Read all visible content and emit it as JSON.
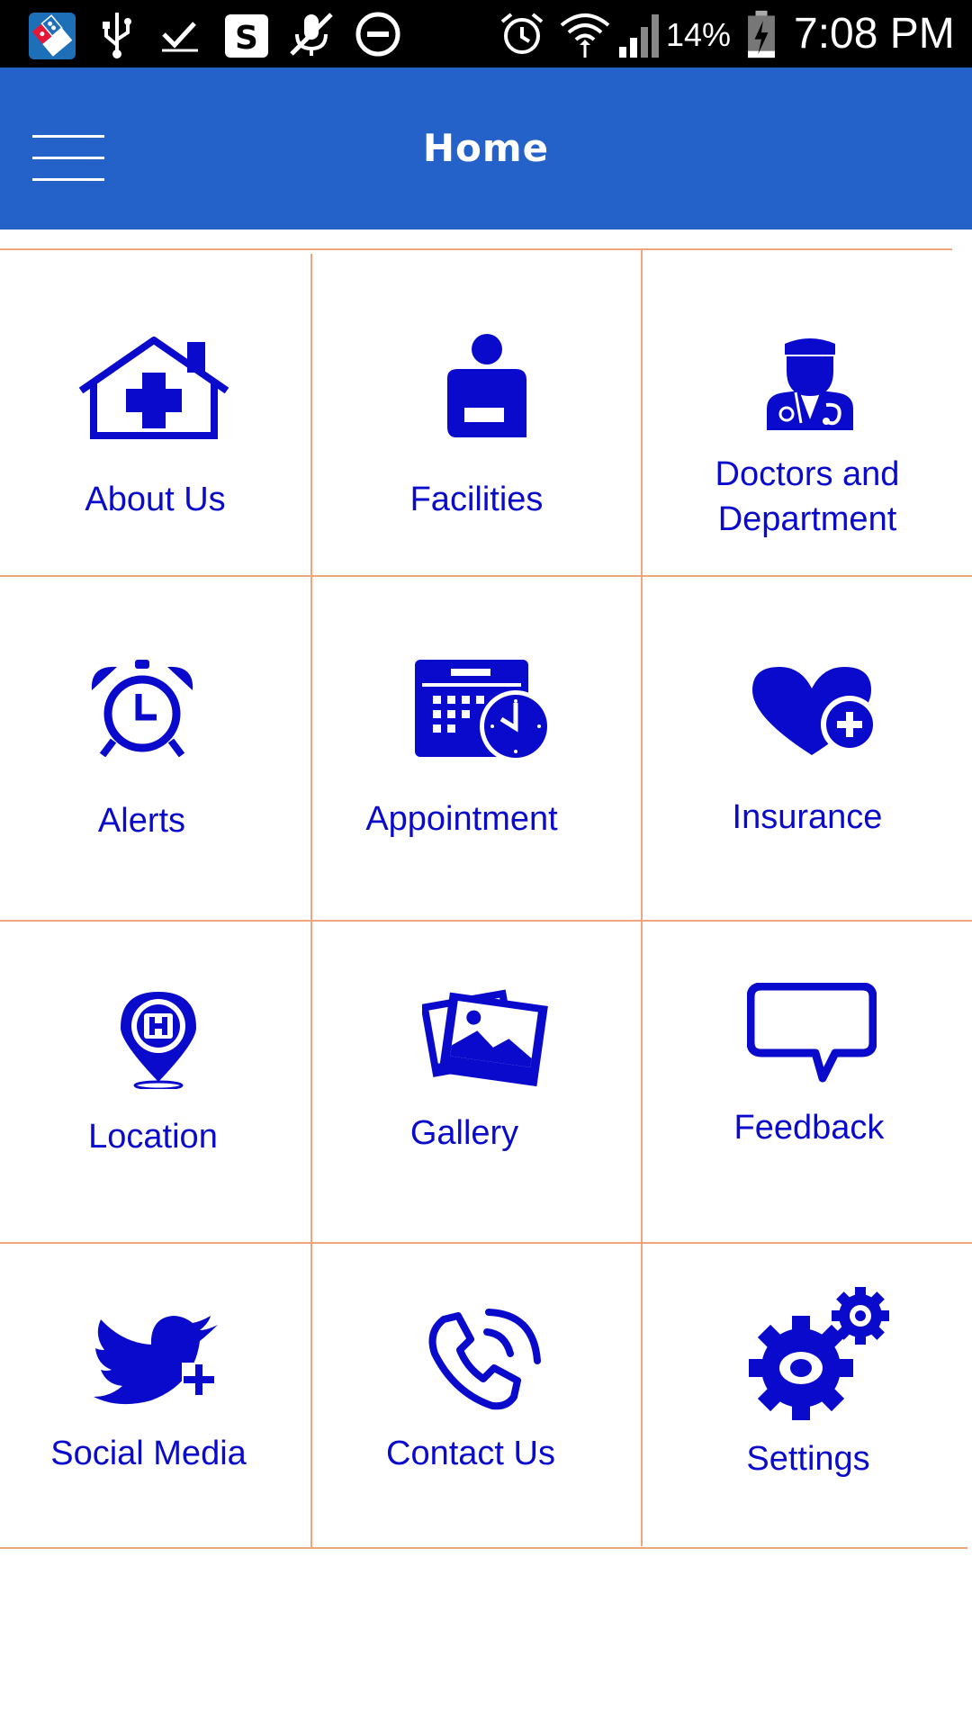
{
  "status_bar": {
    "battery_percent": "14%",
    "time": "7:08 PM",
    "icons": [
      "dominos-app-icon",
      "usb-icon",
      "check-notification-icon",
      "money-icon",
      "mute-mic-icon",
      "do-not-disturb-icon",
      "alarm-icon",
      "wifi-icon",
      "signal-icon",
      "battery-charging-icon"
    ]
  },
  "app_bar": {
    "title": "Home",
    "menu_icon": "hamburger-menu-icon",
    "background_color": "#2462C9"
  },
  "theme": {
    "icon_color": "#0A0ACC",
    "divider_color": "#F0A57C"
  },
  "menu_tiles": [
    {
      "label": "About Us",
      "icon": "house-plus-icon"
    },
    {
      "label": "Facilities",
      "icon": "facilities-person-icon"
    },
    {
      "label": "Doctors and Department",
      "icon": "doctor-icon"
    },
    {
      "label": "Alerts",
      "icon": "alarm-clock-icon"
    },
    {
      "label": "Appointment",
      "icon": "calendar-clock-icon"
    },
    {
      "label": "Insurance",
      "icon": "heart-plus-icon"
    },
    {
      "label": "Location",
      "icon": "hospital-pin-icon"
    },
    {
      "label": "Gallery",
      "icon": "photos-icon"
    },
    {
      "label": "Feedback",
      "icon": "speech-bubble-icon"
    },
    {
      "label": "Social Media",
      "icon": "twitter-plus-icon"
    },
    {
      "label": "Contact Us",
      "icon": "phone-call-icon"
    },
    {
      "label": "Settings",
      "icon": "gears-icon"
    }
  ]
}
